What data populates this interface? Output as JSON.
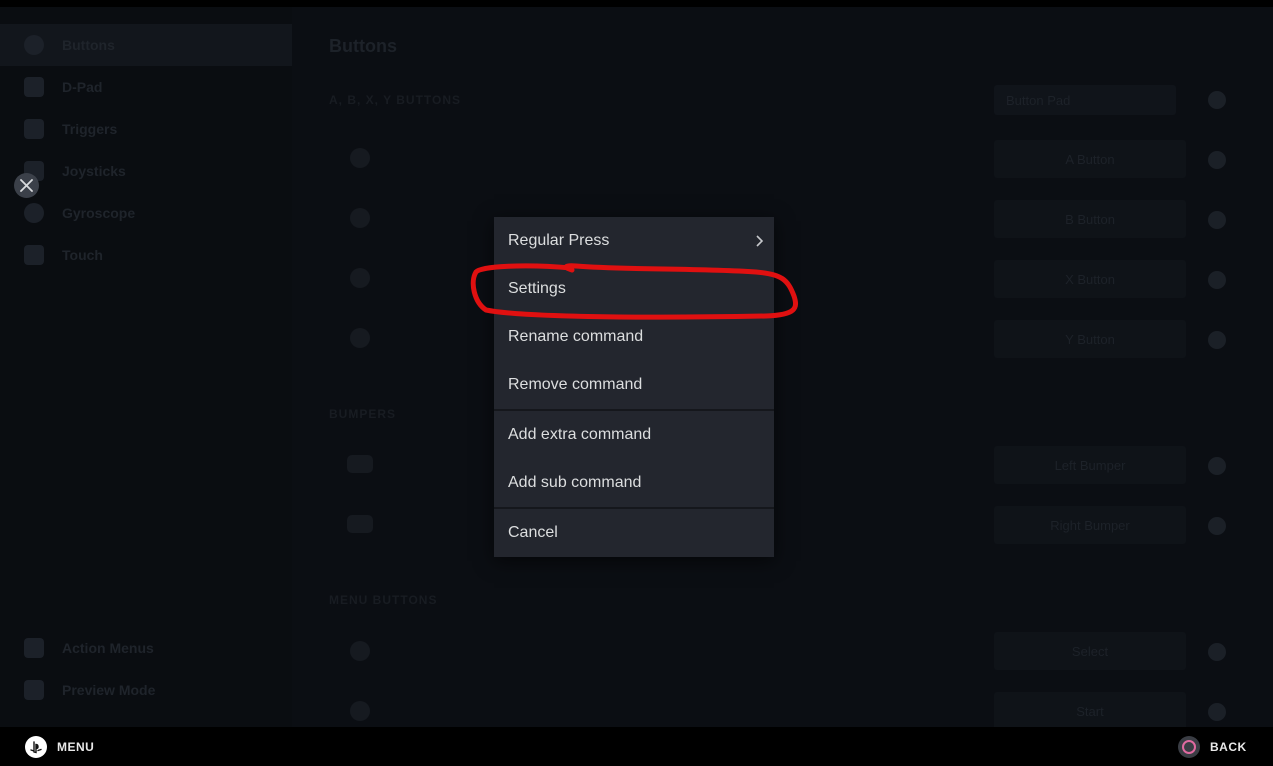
{
  "sidebar": {
    "items": [
      {
        "label": "Buttons"
      },
      {
        "label": "D-Pad"
      },
      {
        "label": "Triggers"
      },
      {
        "label": "Joysticks"
      },
      {
        "label": "Gyroscope"
      },
      {
        "label": "Touch"
      }
    ],
    "footer": [
      {
        "label": "Action Menus"
      },
      {
        "label": "Preview Mode"
      }
    ]
  },
  "main": {
    "title": "Buttons",
    "face_section": "A, B, X, Y BUTTONS",
    "dropdown_value": "Button Pad",
    "face_rows": [
      "A Button",
      "B Button",
      "X Button",
      "Y Button"
    ],
    "bumpers_section": "BUMPERS",
    "bumper_rows": [
      "Left Bumper",
      "Right Bumper"
    ],
    "menu_section": "MENU BUTTONS",
    "menu_rows": [
      "Select",
      "Start"
    ]
  },
  "context_menu": {
    "items": [
      {
        "label": "Regular Press",
        "has_submenu": true
      },
      {
        "label": "Settings"
      },
      {
        "label": "Rename command"
      },
      {
        "label": "Remove command"
      },
      {
        "label": "Add extra command"
      },
      {
        "label": "Add sub command"
      },
      {
        "label": "Cancel"
      }
    ]
  },
  "annotation": {
    "color": "#e01010"
  },
  "bottombar": {
    "menu_label": "MENU",
    "back_label": "BACK"
  }
}
